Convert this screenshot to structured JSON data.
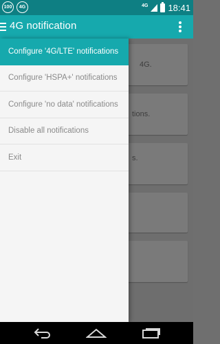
{
  "status_bar": {
    "notif_icon_1": "100",
    "notif_icon_2": "4G",
    "network_label": "4G",
    "time": "18:41"
  },
  "action_bar": {
    "title": "4G notification",
    "menu_icon": "hamburger-icon",
    "overflow_icon": "overflow-menu-icon"
  },
  "drawer": {
    "items": [
      {
        "label": "Configure '4G/LTE' notifications",
        "selected": true
      },
      {
        "label": "Configure 'HSPA+' notifications",
        "selected": false
      },
      {
        "label": "Configure 'no data' notifications",
        "selected": false
      },
      {
        "label": "Disable all notifications",
        "selected": false
      },
      {
        "label": "Exit",
        "selected": false
      }
    ]
  },
  "background_fragments": [
    "4G.",
    "tions.",
    "s."
  ],
  "nav_bar": {
    "back_icon": "back-icon",
    "home_icon": "home-icon",
    "recents_icon": "recents-icon"
  },
  "colors": {
    "status_bar": "#0e7f83",
    "action_bar": "#16a9ad",
    "drawer_bg": "#f5f5f5",
    "drawer_text": "#8a8a8a"
  }
}
